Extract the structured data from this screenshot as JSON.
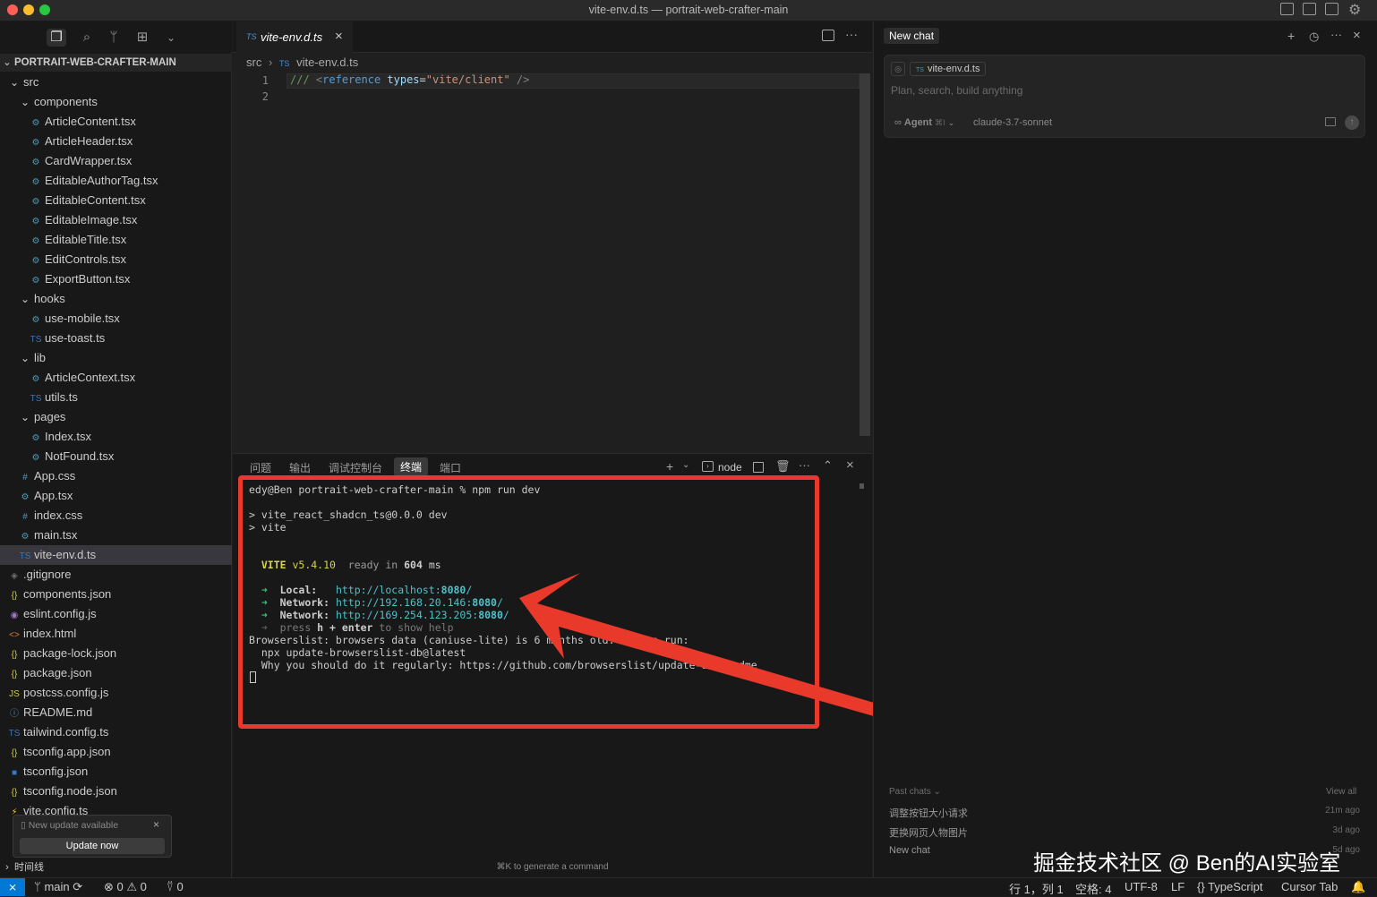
{
  "window": {
    "title": "vite-env.d.ts — portrait-web-crafter-main"
  },
  "explorer": {
    "project": "PORTRAIT-WEB-CRAFTER-MAIN",
    "items": [
      {
        "label": "src",
        "depth": 0,
        "kind": "folder",
        "icon": "⌄"
      },
      {
        "label": "components",
        "depth": 1,
        "kind": "folder",
        "icon": "⌄"
      },
      {
        "label": "ArticleContent.tsx",
        "depth": 2,
        "kind": "react",
        "icon": "⚙"
      },
      {
        "label": "ArticleHeader.tsx",
        "depth": 2,
        "kind": "react",
        "icon": "⚙"
      },
      {
        "label": "CardWrapper.tsx",
        "depth": 2,
        "kind": "react",
        "icon": "⚙"
      },
      {
        "label": "EditableAuthorTag.tsx",
        "depth": 2,
        "kind": "react",
        "icon": "⚙"
      },
      {
        "label": "EditableContent.tsx",
        "depth": 2,
        "kind": "react",
        "icon": "⚙"
      },
      {
        "label": "EditableImage.tsx",
        "depth": 2,
        "kind": "react",
        "icon": "⚙"
      },
      {
        "label": "EditableTitle.tsx",
        "depth": 2,
        "kind": "react",
        "icon": "⚙"
      },
      {
        "label": "EditControls.tsx",
        "depth": 2,
        "kind": "react",
        "icon": "⚙"
      },
      {
        "label": "ExportButton.tsx",
        "depth": 2,
        "kind": "react",
        "icon": "⚙"
      },
      {
        "label": "hooks",
        "depth": 1,
        "kind": "folder",
        "icon": "⌄"
      },
      {
        "label": "use-mobile.tsx",
        "depth": 2,
        "kind": "react",
        "icon": "⚙"
      },
      {
        "label": "use-toast.ts",
        "depth": 2,
        "kind": "ts",
        "icon": "TS"
      },
      {
        "label": "lib",
        "depth": 1,
        "kind": "folder",
        "icon": "⌄"
      },
      {
        "label": "ArticleContext.tsx",
        "depth": 2,
        "kind": "react",
        "icon": "⚙"
      },
      {
        "label": "utils.ts",
        "depth": 2,
        "kind": "ts",
        "icon": "TS"
      },
      {
        "label": "pages",
        "depth": 1,
        "kind": "folder",
        "icon": "⌄"
      },
      {
        "label": "Index.tsx",
        "depth": 2,
        "kind": "react",
        "icon": "⚙"
      },
      {
        "label": "NotFound.tsx",
        "depth": 2,
        "kind": "react",
        "icon": "⚙"
      },
      {
        "label": "App.css",
        "depth": 1,
        "kind": "css",
        "icon": "#"
      },
      {
        "label": "App.tsx",
        "depth": 1,
        "kind": "react",
        "icon": "⚙"
      },
      {
        "label": "index.css",
        "depth": 1,
        "kind": "css",
        "icon": "#"
      },
      {
        "label": "main.tsx",
        "depth": 1,
        "kind": "react",
        "icon": "⚙"
      },
      {
        "label": "vite-env.d.ts",
        "depth": 1,
        "kind": "ts",
        "icon": "TS",
        "selected": true
      },
      {
        "label": ".gitignore",
        "depth": 0,
        "kind": "git",
        "icon": "◈"
      },
      {
        "label": "components.json",
        "depth": 0,
        "kind": "json",
        "icon": "{}"
      },
      {
        "label": "eslint.config.js",
        "depth": 0,
        "kind": "eslint",
        "icon": "◉"
      },
      {
        "label": "index.html",
        "depth": 0,
        "kind": "html",
        "icon": "<>"
      },
      {
        "label": "package-lock.json",
        "depth": 0,
        "kind": "json",
        "icon": "{}"
      },
      {
        "label": "package.json",
        "depth": 0,
        "kind": "json",
        "icon": "{}"
      },
      {
        "label": "postcss.config.js",
        "depth": 0,
        "kind": "js",
        "icon": "JS"
      },
      {
        "label": "README.md",
        "depth": 0,
        "kind": "info",
        "icon": "ⓘ"
      },
      {
        "label": "tailwind.config.ts",
        "depth": 0,
        "kind": "ts",
        "icon": "TS"
      },
      {
        "label": "tsconfig.app.json",
        "depth": 0,
        "kind": "json",
        "icon": "{}"
      },
      {
        "label": "tsconfig.json",
        "depth": 0,
        "kind": "tsjson",
        "icon": "■"
      },
      {
        "label": "tsconfig.node.json",
        "depth": 0,
        "kind": "json",
        "icon": "{}"
      },
      {
        "label": "vite.config.ts",
        "depth": 0,
        "kind": "vite",
        "icon": "⚡"
      }
    ],
    "timeline_label": "时间线"
  },
  "update_toast": {
    "message": "New update available",
    "button": "Update now"
  },
  "editor": {
    "tab": {
      "badge": "TS",
      "label": "vite-env.d.ts"
    },
    "breadcrumb": {
      "folder": "src",
      "badge": "TS",
      "file": "vite-env.d.ts"
    },
    "lines": [
      {
        "num": "1",
        "tokens": [
          {
            "t": "/// ",
            "c": "#6a9955"
          },
          {
            "t": "<",
            "c": "#808080"
          },
          {
            "t": "reference",
            "c": "#569cd6"
          },
          {
            "t": " ",
            "c": "#d4d4d4"
          },
          {
            "t": "types",
            "c": "#9cdcfe"
          },
          {
            "t": "=",
            "c": "#d4d4d4"
          },
          {
            "t": "\"vite/client\"",
            "c": "#ce9178"
          },
          {
            "t": " ",
            "c": "#d4d4d4"
          },
          {
            "t": "/>",
            "c": "#808080"
          }
        ]
      },
      {
        "num": "2",
        "tokens": []
      }
    ]
  },
  "panel": {
    "tabs": [
      "问题",
      "输出",
      "调试控制台",
      "终端",
      "端口"
    ],
    "active_tab": "终端",
    "terminal_name": "node",
    "hint": "⌘K to generate a command",
    "lines": [
      [
        {
          "t": "edy@Ben portrait-web-crafter-main % npm run dev"
        }
      ],
      [],
      [
        {
          "t": "> vite_react_shadcn_ts@0.0.0 dev"
        }
      ],
      [
        {
          "t": "> vite"
        }
      ],
      [],
      [],
      [
        {
          "t": "  "
        },
        {
          "t": "VITE",
          "c": "#d4d44a",
          "b": true
        },
        {
          "t": " v5.4.10",
          "c": "#d4d44a"
        },
        {
          "t": "  ready in ",
          "c": "#9a9a9a"
        },
        {
          "t": "604",
          "b": true
        },
        {
          "t": " ms",
          "c": "#cccccc"
        }
      ],
      [],
      [
        {
          "t": "  ➜  ",
          "c": "#3fbf7f"
        },
        {
          "t": "Local:",
          "b": true
        },
        {
          "t": "   "
        },
        {
          "t": "http://localhost:",
          "c": "#4fc1c9"
        },
        {
          "t": "8080",
          "c": "#4fc1c9",
          "b": true
        },
        {
          "t": "/",
          "c": "#4fc1c9"
        }
      ],
      [
        {
          "t": "  ➜  ",
          "c": "#3fbf7f"
        },
        {
          "t": "Network:",
          "b": true
        },
        {
          "t": " "
        },
        {
          "t": "http://192.168.20.146:",
          "c": "#4fc1c9"
        },
        {
          "t": "8080",
          "c": "#4fc1c9",
          "b": true
        },
        {
          "t": "/",
          "c": "#4fc1c9"
        }
      ],
      [
        {
          "t": "  ➜  ",
          "c": "#3fbf7f"
        },
        {
          "t": "Network:",
          "b": true
        },
        {
          "t": " "
        },
        {
          "t": "http://169.254.123.205:",
          "c": "#4fc1c9"
        },
        {
          "t": "8080",
          "c": "#4fc1c9",
          "b": true
        },
        {
          "t": "/",
          "c": "#4fc1c9"
        }
      ],
      [
        {
          "t": "  ➜  ",
          "c": "#5a5a5a"
        },
        {
          "t": "press ",
          "c": "#7a7a7a"
        },
        {
          "t": "h + enter",
          "b": true
        },
        {
          "t": " to show help",
          "c": "#7a7a7a"
        }
      ],
      [
        {
          "t": "Browserslist: browsers data (caniuse-lite) is 6 months old. Please run:"
        }
      ],
      [
        {
          "t": "  npx update-browserslist-db@latest"
        }
      ],
      [
        {
          "t": "  Why you should do it regularly: https://github.com/browserslist/update-db#readme"
        }
      ]
    ]
  },
  "chat": {
    "header_label": "New chat",
    "context_badge": "TS",
    "context_file": "vite-env.d.ts",
    "placeholder": "Plan, search, build anything",
    "mode": "Agent",
    "mode_shortcut": "⌘I",
    "model": "claude-3.7-sonnet",
    "past_label": "Past chats",
    "view_all": "View all",
    "past": [
      {
        "title": "调整按钮大小请求",
        "time": "21m ago"
      },
      {
        "title": "更换网页人物图片",
        "time": "3d ago"
      },
      {
        "title": "New chat",
        "time": "5d ago"
      }
    ]
  },
  "status": {
    "branch": "main",
    "errors": "0",
    "warnings": "0",
    "ports": "0",
    "position": "行 1，列 1",
    "spaces": "空格: 4",
    "encoding": "UTF-8",
    "eol": "LF",
    "language": "TypeScript",
    "cursor_tab": "Cursor Tab"
  },
  "watermark": "掘金技术社区 @ Ben的AI实验室",
  "colors": {
    "accent": "#0078d4",
    "annotation_red": "#e8392b"
  }
}
